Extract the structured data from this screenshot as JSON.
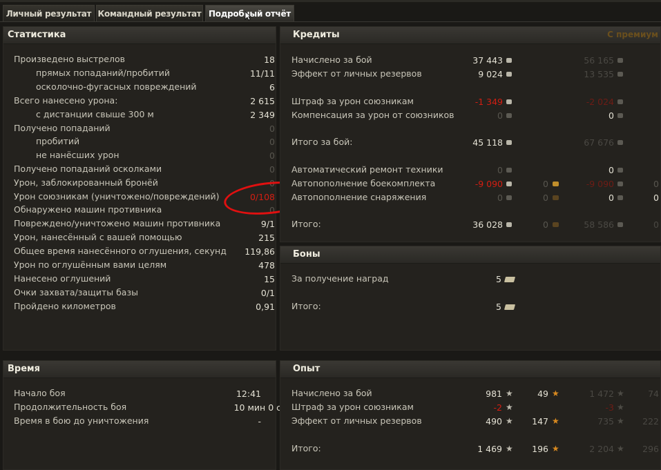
{
  "tabs": [
    {
      "label": "Личный результат"
    },
    {
      "label": "Командный результат"
    },
    {
      "label": "Подробный отчёт"
    }
  ],
  "statistics": {
    "title": "Статистика",
    "rows": [
      {
        "label": "Произведено выстрелов",
        "value": "18"
      },
      {
        "label": "прямых попаданий/пробитий",
        "value": "11/11"
      },
      {
        "label": "осколочно-фугасных повреждений",
        "value": "6"
      },
      {
        "label": "Всего нанесено урона:",
        "value": "2 615"
      },
      {
        "label": "с дистанции свыше 300 м",
        "value": "2 349"
      },
      {
        "label": "Получено попаданий",
        "value": "0"
      },
      {
        "label": "пробитий",
        "value": "0"
      },
      {
        "label": "не нанёсших урон",
        "value": "0"
      },
      {
        "label": "Получено попаданий осколками",
        "value": "0"
      },
      {
        "label": "Урон, заблокированный бронёй",
        "value": "0"
      },
      {
        "label": "Урон союзникам (уничтожено/повреждений)",
        "value": "0/108"
      },
      {
        "label": "Обнаружено машин противника",
        "value": "0"
      },
      {
        "label": "Повреждено/уничтожено машин противника",
        "value": "9/1"
      },
      {
        "label": "Урон, нанесённый с вашей помощью",
        "value": "215"
      },
      {
        "label": "Общее время нанесённого оглушения, секунд",
        "value": "119,86"
      },
      {
        "label": "Урон по оглушённым вами целям",
        "value": "478"
      },
      {
        "label": "Нанесено оглушений",
        "value": "15"
      },
      {
        "label": "Очки захвата/защиты базы",
        "value": "0/1"
      },
      {
        "label": "Пройдено километров",
        "value": "0,91"
      }
    ]
  },
  "time": {
    "title": "Время",
    "rows": [
      {
        "label": "Начало боя",
        "value": "12:41"
      },
      {
        "label": "Продолжительность боя",
        "value": "10 мин 0 с"
      },
      {
        "label": "Время в бою до уничтожения",
        "value": "-"
      }
    ]
  },
  "credits": {
    "title": "Кредиты",
    "premium_label": "С премиум",
    "rows": [
      {
        "label": "Начислено за бой",
        "credits": "37 443",
        "prem_credits": "56 165"
      },
      {
        "label": "Эффект от личных резервов",
        "credits": "9 024",
        "prem_credits": "13 535"
      },
      {
        "label": "Штраф за урон союзникам",
        "credits": "-1 349",
        "prem_credits": "-2 024"
      },
      {
        "label": "Компенсация за урон от союзников",
        "credits": "0",
        "prem_credits": "0"
      },
      {
        "label": "Итого за бой:",
        "credits": "45 118",
        "prem_credits": "67 676"
      },
      {
        "label": "Автоматический ремонт техники",
        "credits": "0",
        "prem_credits": "0"
      },
      {
        "label": "Автопополнение боекомплекта",
        "credits": "-9 090",
        "gold": "0",
        "prem_credits": "-9 090",
        "prem_gold": "0"
      },
      {
        "label": "Автопополнение снаряжения",
        "credits": "0",
        "gold": "0",
        "prem_credits": "0",
        "prem_gold": "0"
      },
      {
        "label": "Итого:",
        "credits": "36 028",
        "gold": "0",
        "prem_credits": "58 586",
        "prem_gold": "0"
      }
    ]
  },
  "bonds": {
    "title": "Боны",
    "rows": [
      {
        "label": "За получение наград",
        "value": "5"
      },
      {
        "label": "Итого:",
        "value": "5"
      }
    ]
  },
  "experience": {
    "title": "Опыт",
    "rows": [
      {
        "label": "Начислено за бой",
        "xp": "981",
        "free_xp": "49",
        "prem_xp": "1 472",
        "prem_free_xp": "74"
      },
      {
        "label": "Штраф за урон союзникам",
        "xp": "-2",
        "prem_xp": "-3"
      },
      {
        "label": "Эффект от личных резервов",
        "xp": "490",
        "free_xp": "147",
        "prem_xp": "735",
        "prem_free_xp": "222"
      },
      {
        "label": "Итого:",
        "xp": "1 469",
        "free_xp": "196",
        "prem_xp": "2 204",
        "prem_free_xp": "296"
      }
    ]
  },
  "colors": {
    "accent_red": "#d41e12",
    "annotation_circle": "#e01010",
    "premium_text": "#6a4f1d"
  },
  "icons": {
    "credits": "credit-coin-icon",
    "gold": "gold-coin-icon",
    "bonds": "bond-icon",
    "xp": "star-icon",
    "free_xp": "free-xp-star-icon"
  }
}
